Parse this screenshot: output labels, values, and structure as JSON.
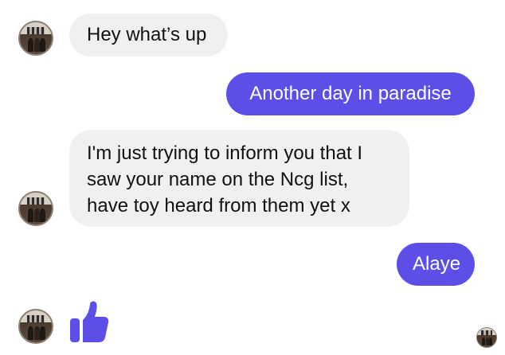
{
  "messages": [
    {
      "direction": "incoming",
      "lines": [
        "Hey what’s up"
      ]
    },
    {
      "direction": "outgoing",
      "lines": [
        "Another day in paradise"
      ]
    },
    {
      "direction": "incoming",
      "lines": [
        "I'm just trying to inform you that I",
        "saw your name on the Ncg list,",
        "have toy heard from them yet x"
      ]
    },
    {
      "direction": "outgoing",
      "lines": [
        "Alaye"
      ]
    }
  ],
  "reaction": {
    "icon": "thumbs-up-icon",
    "color": "#5b4fe8"
  },
  "colors": {
    "incoming_bubble": "#f0f0f0",
    "outgoing_bubble": "#5b4fe8",
    "incoming_text": "#111111",
    "outgoing_text": "#ffffff"
  }
}
